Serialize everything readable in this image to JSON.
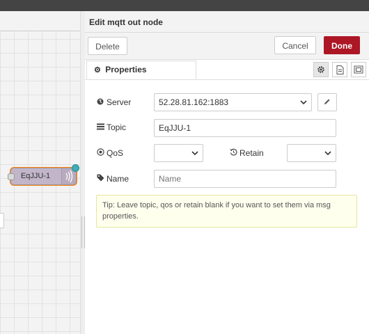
{
  "dialog": {
    "title": "Edit mqtt out node",
    "delete_label": "Delete",
    "cancel_label": "Cancel",
    "done_label": "Done",
    "tab_properties": "Properties"
  },
  "workspace": {
    "node_label": "EqJJU-1"
  },
  "form": {
    "server_label": "Server",
    "server_value": "52.28.81.162:1883",
    "topic_label": "Topic",
    "topic_value": "EqJJU-1",
    "qos_label": "QoS",
    "qos_value": "",
    "retain_label": "Retain",
    "retain_value": "",
    "name_label": "Name",
    "name_placeholder": "Name",
    "tip": "Tip: Leave topic, qos or retain blank if you want to set them via msg properties."
  },
  "colors": {
    "done_button": "#ad1625",
    "node_fill": "#c2b5c9",
    "changed_dot": "#3fadb5",
    "tip_background": "#ffffee"
  },
  "icons": [
    "gear-icon",
    "description-icon",
    "appearance-icon",
    "globe-icon",
    "tasks-icon",
    "dot-circle-icon",
    "history-icon",
    "tag-icon",
    "pencil-icon",
    "chevron-down-icon",
    "mqtt-wave-icon"
  ]
}
